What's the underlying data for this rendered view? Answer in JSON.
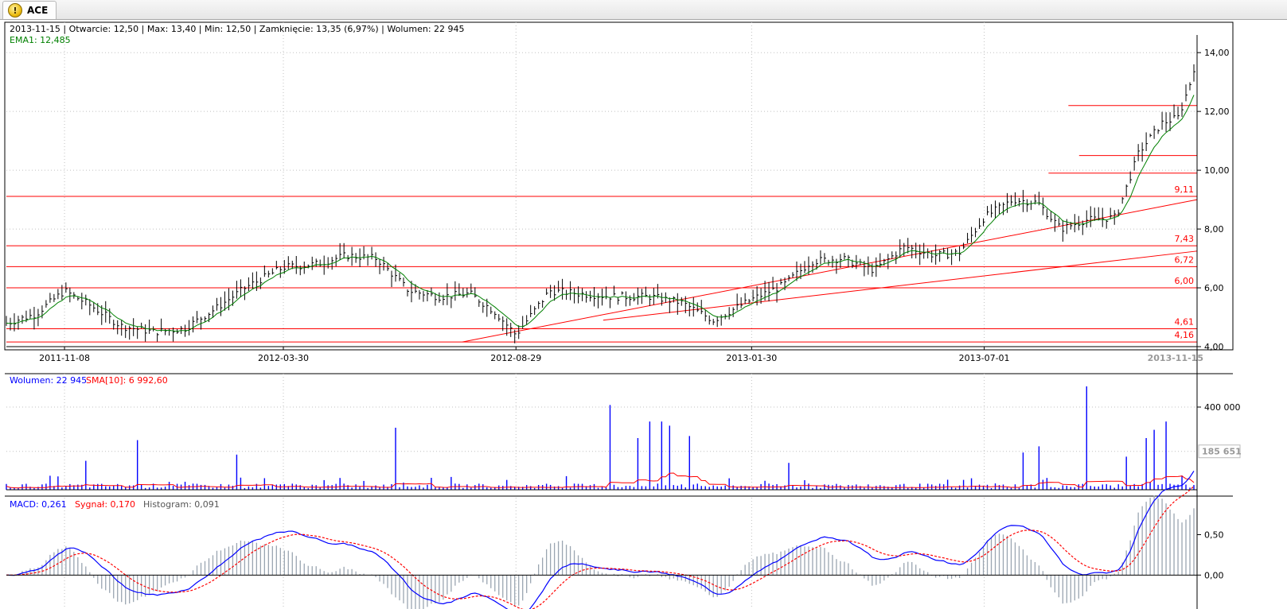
{
  "window": {
    "tab_title": "ACE",
    "tab_icon": "warning-coin-icon"
  },
  "colors": {
    "price_bar": "#000000",
    "ema": "#008000",
    "level_line": "#ff0000",
    "volume_bar": "#0000ff",
    "sma": "#ff0000",
    "macd": "#0000ff",
    "signal": "#ff0000",
    "histogram": "#9aa5b1",
    "grid": "#c0c0c0"
  },
  "price_panel": {
    "info_line": "2013-11-15 | Otwarcie: 12,50 | Max: 13,40 | Min: 12,50 | Zamknięcie: 13,35 (6,97%) | Wolumen: 22 945",
    "ema_label": "EMA1: 12,485",
    "x_ticks": [
      "2011-11-08",
      "2012-03-30",
      "2012-08-29",
      "2013-01-30",
      "2013-07-01"
    ],
    "x_current": "2013-11-15",
    "y_ticks": [
      "4,00",
      "6,00",
      "8,00",
      "10,00",
      "12,00",
      "14,00"
    ],
    "level_labels": [
      "9,11",
      "7,43",
      "6,72",
      "6,00",
      "4,61",
      "4,16"
    ]
  },
  "volume_panel": {
    "volume_label": "Wolumen: 22 945",
    "sma_label": "SMA[10]: 6 992,60",
    "y_ticks": [
      "400 000"
    ],
    "current_value": "185 651"
  },
  "macd_panel": {
    "macd_label": "MACD: 0,261",
    "signal_label": "Sygnał: 0,170",
    "histogram_label": "Histogram: 0,091",
    "y_ticks": [
      "0,50",
      "0,00"
    ]
  },
  "chart_data": [
    {
      "type": "line",
      "name_hint": "price-ohlc",
      "xlim": [
        "2011-10-01",
        "2013-11-15"
      ],
      "ylim": [
        4.0,
        14.6
      ],
      "date_ticks": [
        {
          "date": "2011-11-08",
          "x_frac": 0.0
        },
        {
          "date": "2012-03-30",
          "x_frac": 0.0
        },
        {
          "date": "2012-08-29",
          "x_frac": 0.0
        },
        {
          "date": "2013-01-30",
          "x_frac": 0.0
        },
        {
          "date": "2013-07-01",
          "x_frac": 0.0
        }
      ],
      "close_series": {
        "dates": [
          "2011-10-01",
          "2011-10-20",
          "2011-11-08",
          "2011-11-25",
          "2011-12-15",
          "2012-01-05",
          "2012-01-25",
          "2012-02-15",
          "2012-03-05",
          "2012-03-30",
          "2012-04-20",
          "2012-05-10",
          "2012-05-30",
          "2012-06-20",
          "2012-07-10",
          "2012-07-30",
          "2012-08-15",
          "2012-08-29",
          "2012-09-20",
          "2012-10-10",
          "2012-11-01",
          "2012-11-25",
          "2012-12-15",
          "2013-01-05",
          "2013-01-30",
          "2013-02-20",
          "2013-03-10",
          "2013-03-30",
          "2013-04-20",
          "2013-05-10",
          "2013-05-30",
          "2013-06-15",
          "2013-07-01",
          "2013-07-20",
          "2013-08-05",
          "2013-08-20",
          "2013-09-05",
          "2013-09-25",
          "2013-10-10",
          "2013-10-25",
          "2013-11-05",
          "2013-11-15"
        ],
        "values": [
          4.8,
          5.1,
          5.9,
          5.4,
          4.7,
          4.5,
          4.6,
          5.3,
          6.0,
          6.7,
          6.8,
          7.1,
          7.0,
          5.9,
          5.7,
          5.8,
          5.2,
          4.4,
          5.9,
          5.8,
          5.7,
          5.7,
          5.5,
          4.9,
          5.6,
          6.1,
          6.9,
          7.0,
          6.6,
          7.4,
          7.1,
          7.2,
          8.4,
          9.0,
          8.9,
          8.0,
          8.3,
          8.4,
          10.6,
          11.6,
          11.8,
          13.35
        ]
      },
      "ema1": 12.485,
      "horizontal_levels": [
        9.11,
        7.43,
        6.72,
        6.0,
        4.61,
        4.16
      ]
    },
    {
      "type": "bar",
      "name_hint": "volume",
      "ylim": [
        0,
        500000
      ],
      "last_volume": 22945,
      "sma10": 6992.6
    },
    {
      "type": "line",
      "name_hint": "macd",
      "ylim": [
        -0.08,
        0.16
      ],
      "macd": 0.261,
      "signal": 0.17,
      "histogram": 0.091
    }
  ]
}
